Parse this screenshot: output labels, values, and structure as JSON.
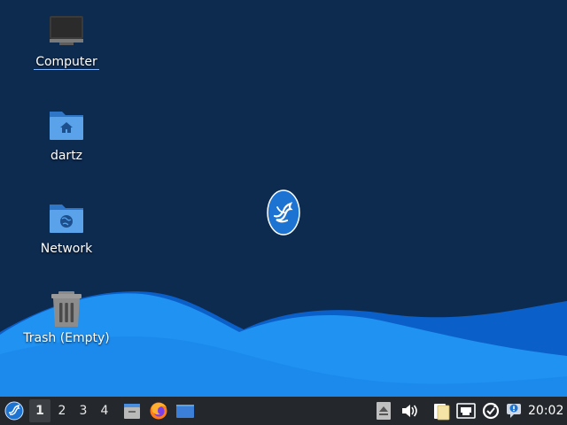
{
  "desktop": {
    "icons": [
      {
        "label": "Computer",
        "icon": "computer-icon"
      },
      {
        "label": "dartz",
        "icon": "home-folder-icon"
      },
      {
        "label": "Network",
        "icon": "network-folder-icon"
      },
      {
        "label": "Trash (Empty)",
        "icon": "trash-icon"
      }
    ],
    "center_logo": "lubuntu-bird-logo",
    "colors": {
      "background": "#0d2a4f",
      "wave_light": "#1e90f0",
      "wave_dark": "#0b5cbf"
    }
  },
  "taskbar": {
    "start_icon": "lubuntu-start-icon",
    "workspaces": [
      "1",
      "2",
      "3",
      "4"
    ],
    "active_workspace": "1",
    "launchers": [
      "file-manager-icon",
      "firefox-icon",
      "show-desktop-icon"
    ],
    "tray": [
      "eject-icon",
      "volume-icon",
      "clipboard-icon",
      "network-icon",
      "update-icon",
      "notification-icon"
    ],
    "clock": "20:02",
    "colors": {
      "background": "#24272b"
    }
  }
}
